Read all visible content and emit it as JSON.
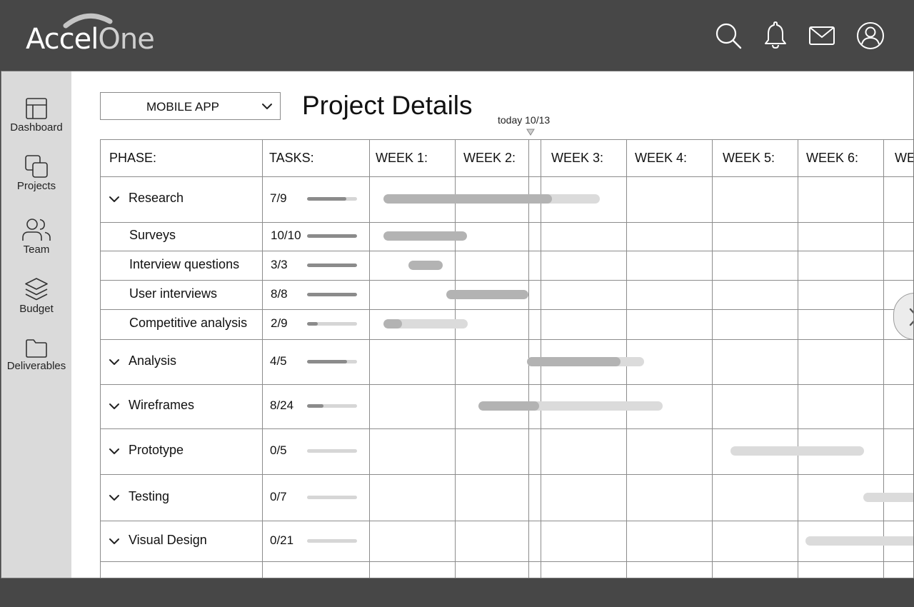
{
  "app": {
    "logo_part1": "Accel",
    "logo_part2": "One"
  },
  "header": {
    "icons": [
      "search-icon",
      "bell-icon",
      "mail-icon",
      "user-icon"
    ]
  },
  "sidebar": {
    "items": [
      {
        "label": "Dashboard",
        "icon": "dashboard-icon"
      },
      {
        "label": "Projects",
        "icon": "projects-icon"
      },
      {
        "label": "Team",
        "icon": "team-icon"
      },
      {
        "label": "Budget",
        "icon": "layers-icon"
      },
      {
        "label": "Deliverables",
        "icon": "folder-icon"
      }
    ]
  },
  "project": {
    "selected": "MOBILE APP",
    "title": "Project Details",
    "today_label": "today 10/13"
  },
  "gantt": {
    "headers": {
      "phase": "PHASE:",
      "tasks": "TASKS:",
      "weeks": [
        "WEEK 1:",
        "WEEK 2:",
        "WEEK 3:",
        "WEEK 4:",
        "WEEK 5:",
        "WEEK 6:",
        "WE"
      ]
    },
    "rows": [
      {
        "type": "phase",
        "name": "Research",
        "count": "7/9",
        "progress": 0.78
      },
      {
        "type": "task",
        "name": "Surveys",
        "count": "10/10",
        "progress": 1.0
      },
      {
        "type": "task",
        "name": "Interview questions",
        "count": "3/3",
        "progress": 1.0
      },
      {
        "type": "task",
        "name": "User interviews",
        "count": "8/8",
        "progress": 1.0
      },
      {
        "type": "task",
        "name": "Competitive analysis",
        "count": "2/9",
        "progress": 0.22
      },
      {
        "type": "phase",
        "name": "Analysis",
        "count": "4/5",
        "progress": 0.8
      },
      {
        "type": "phase",
        "name": "Wireframes",
        "count": "8/24",
        "progress": 0.33
      },
      {
        "type": "phase",
        "name": "Prototype",
        "count": "0/5",
        "progress": 0.0
      },
      {
        "type": "phase",
        "name": "Testing",
        "count": "0/7",
        "progress": 0.0
      },
      {
        "type": "phase",
        "name": "Visual Design",
        "count": "0/21",
        "progress": 0.0
      }
    ]
  }
}
